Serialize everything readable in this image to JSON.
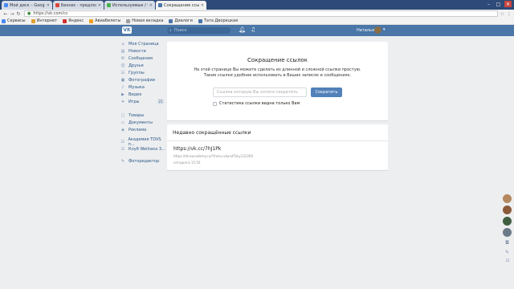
{
  "browser": {
    "tabs": [
      {
        "label": "Мой диск – Google Диск",
        "favicon_color": "#4a8af4",
        "active": false
      },
      {
        "label": "Бизнес - предложение",
        "favicon_color": "#db4437",
        "active": false
      },
      {
        "label": "Используемые / Сайты",
        "favicon_color": "#4caf50",
        "active": false
      },
      {
        "label": "Сокращение ссылок",
        "favicon_color": "#4a76a8",
        "active": true
      }
    ],
    "url": "https://vk.com/cc",
    "bookmarks": [
      {
        "label": "Сервисы",
        "color": "#4a8af4"
      },
      {
        "label": "Интернет",
        "color": "#e0a030"
      },
      {
        "label": "Яндекс",
        "color": "#d32f2f"
      },
      {
        "label": "Авиабилеты",
        "color": "#f0a020"
      },
      {
        "label": "Новая вкладка",
        "color": "#9e9e9e"
      },
      {
        "label": "Диалоги",
        "color": "#4a76a8"
      },
      {
        "label": "Тата Дворецкая",
        "color": "#4a76a8"
      }
    ]
  },
  "header": {
    "logo": "VK",
    "search_placeholder": "Поиск",
    "user_name": "Наталья"
  },
  "sidebar": {
    "group1": [
      {
        "label": "Моя Страница",
        "icon": "home-icon"
      },
      {
        "label": "Новости",
        "icon": "news-icon"
      },
      {
        "label": "Сообщения",
        "icon": "messages-icon"
      },
      {
        "label": "Друзья",
        "icon": "friends-icon"
      },
      {
        "label": "Группы",
        "icon": "groups-icon"
      },
      {
        "label": "Фотографии",
        "icon": "photos-icon"
      },
      {
        "label": "Музыка",
        "icon": "music-icon"
      },
      {
        "label": "Видео",
        "icon": "video-icon"
      },
      {
        "label": "Игры",
        "icon": "games-icon",
        "badge": "21"
      }
    ],
    "group2": [
      {
        "label": "Товары",
        "icon": "goods-icon"
      },
      {
        "label": "Документы",
        "icon": "documents-icon"
      },
      {
        "label": "Реклама",
        "icon": "ads-icon"
      }
    ],
    "group3": [
      {
        "label": "Академия TDVS п...",
        "icon": "community-icon"
      },
      {
        "label": "Клуб Wellness 3...",
        "icon": "community-icon"
      }
    ],
    "group4": [
      {
        "label": "Фоторедактор",
        "icon": "photo-editor-icon"
      }
    ]
  },
  "shortener": {
    "title": "Сокращение ссылок",
    "description_line1": "На этой странице Вы можете сделать из длинной и сложной ссылки простую.",
    "description_line2": "Такие ссылки удобнее использовать в Ваших записях и сообщениях.",
    "input_placeholder": "Ссылка которую Вы хотите сократить",
    "button_label": "Сократить",
    "stats_checkbox_label": "Статистика ссылки видна только Вам"
  },
  "recent": {
    "heading": "Недавно сокращённые ссылки",
    "short_link": "https://vk.cc/7hJ1Pk",
    "original_link": "https://tdvsacademy.ru/?from=vkandTkky131200",
    "time": "сегодня в 15:50"
  },
  "chat_bar": {
    "avatar_colors": [
      "#b48860",
      "#8a5a3a",
      "#3f5e3f",
      "#6b7a88"
    ],
    "count": "22"
  }
}
